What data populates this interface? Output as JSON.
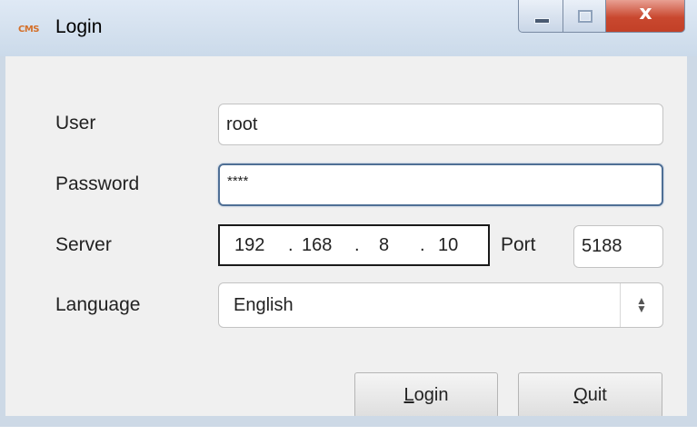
{
  "window": {
    "title": "Login",
    "app_icon_text": "CMS",
    "controls": {
      "minimize": "minimize",
      "maximize": "maximize",
      "close": "x"
    }
  },
  "form": {
    "user_label": "User",
    "user_value": "root",
    "password_label": "Password",
    "password_value": "****",
    "server_label": "Server",
    "server_ip": [
      "192",
      "168",
      "8",
      "10"
    ],
    "ip_separator": ".",
    "port_label": "Port",
    "port_value": "5188",
    "language_label": "Language",
    "language_value": "English"
  },
  "buttons": {
    "login_mnemonic": "L",
    "login_rest": "ogin",
    "quit_mnemonic": "Q",
    "quit_rest": "uit"
  },
  "colors": {
    "focus_border": "#4f6f95",
    "close_button": "#c9482f",
    "dialog_background": "#f0f0f0"
  }
}
